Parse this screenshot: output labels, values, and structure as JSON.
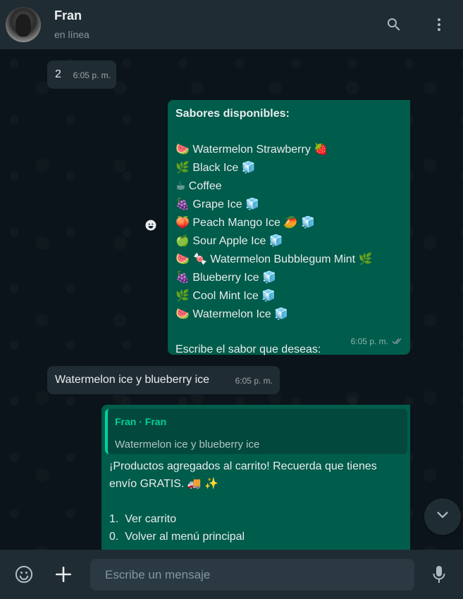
{
  "header": {
    "contact_name": "Fran",
    "status": "en línea"
  },
  "messages": [
    {
      "direction": "in",
      "text": "2",
      "time": "6:05 p. m."
    },
    {
      "direction": "out",
      "title": "Sabores disponibles:",
      "flavors": [
        {
          "emoji": "🍉",
          "label": "Watermelon Strawberry",
          "suffix": "🍓"
        },
        {
          "emoji": "🌿",
          "label": "Black Ice",
          "suffix": "🧊"
        },
        {
          "emoji": "☕",
          "label": "Coffee",
          "suffix": ""
        },
        {
          "emoji": "🍇",
          "label": "Grape Ice",
          "suffix": "🧊"
        },
        {
          "emoji": "🍑",
          "label": "Peach Mango Ice",
          "suffix": "🥭 🧊"
        },
        {
          "emoji": "🍏",
          "label": "Sour Apple Ice",
          "suffix": "🧊"
        },
        {
          "emoji": "🍉 🍬",
          "label": "Watermelon Bubblegum Mint",
          "suffix": "🌿"
        },
        {
          "emoji": "🍇",
          "label": "Blueberry Ice",
          "suffix": "🧊"
        },
        {
          "emoji": "🌿",
          "label": "Cool Mint Ice",
          "suffix": "🧊"
        },
        {
          "emoji": "🍉",
          "label": "Watermelon Ice",
          "suffix": "🧊"
        }
      ],
      "footer": "Escribe el sabor que deseas:",
      "time": "6:05 p. m.",
      "status": "read"
    },
    {
      "direction": "in",
      "text": "Watermelon ice y blueberry ice",
      "time": "6:05 p. m."
    },
    {
      "direction": "out",
      "quote_author": "Fran · Fran",
      "quote_text": "Watermelon ice y blueberry ice",
      "line1": "¡Productos agregados al carrito! Recuerda que tienes",
      "line2": "envío GRATIS. 🚚 ✨",
      "options": [
        "1.  Ver carrito",
        "0.  Volver al menú principal"
      ]
    }
  ],
  "composer": {
    "placeholder": "Escribe un mensaje"
  },
  "icons": {
    "search": "search-icon",
    "menu": "more-vertical-icon",
    "emoji": "emoji-icon",
    "attach": "plus-icon",
    "mic": "microphone-icon",
    "scroll": "chevron-down-icon",
    "react": "smiley-icon"
  },
  "colors": {
    "header_bg": "#202c33",
    "chat_bg": "#0b141a",
    "incoming_bubble": "#202c33",
    "outgoing_bubble": "#005c4b",
    "accent": "#06cf9c"
  }
}
